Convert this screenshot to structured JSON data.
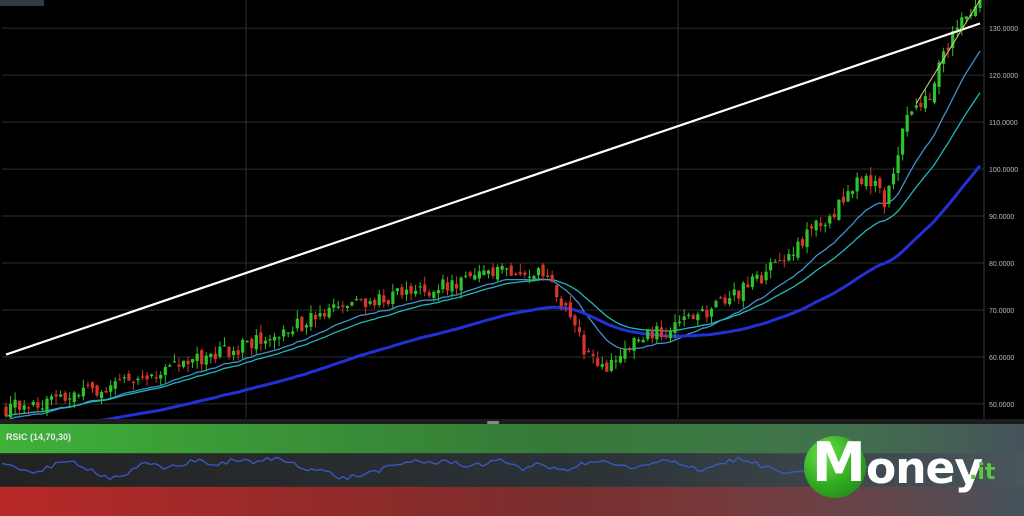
{
  "chart_data": [
    {
      "type": "candlestick",
      "title": "",
      "ylim": [
        47,
        136
      ],
      "yticks": [
        50,
        60,
        70,
        80,
        90,
        100,
        110,
        120,
        130
      ],
      "ytick_labels": [
        "50.0000",
        "60.0000",
        "70.0000",
        "80.0000",
        "90.0000",
        "100.0000",
        "110.0000",
        "120.0000",
        "130.0000"
      ],
      "grid": true,
      "candles": {
        "count": 215,
        "close": [
          [
            0,
            49
          ],
          [
            15,
            52
          ],
          [
            30,
            56
          ],
          [
            45,
            60
          ],
          [
            60,
            65
          ],
          [
            70,
            69
          ],
          [
            80,
            72
          ],
          [
            95,
            75
          ],
          [
            105,
            77
          ],
          [
            112,
            79
          ],
          [
            118,
            77
          ],
          [
            122,
            72
          ],
          [
            125,
            66
          ],
          [
            128,
            60
          ],
          [
            131,
            57
          ],
          [
            134,
            60
          ],
          [
            138,
            63
          ],
          [
            142,
            65
          ],
          [
            148,
            67
          ],
          [
            155,
            70
          ],
          [
            163,
            75
          ],
          [
            170,
            80
          ],
          [
            177,
            87
          ],
          [
            184,
            93
          ],
          [
            188,
            98
          ],
          [
            191,
            97
          ],
          [
            193,
            93
          ],
          [
            195,
            100
          ],
          [
            197,
            108
          ],
          [
            200,
            114
          ],
          [
            203,
            116
          ],
          [
            206,
            125
          ],
          [
            209,
            130
          ],
          [
            212,
            134
          ],
          [
            214,
            136
          ]
        ]
      },
      "trendlines": [
        {
          "points": [
            [
              0,
              60.5
            ],
            [
              214,
              131
            ]
          ],
          "color": "#ffffff"
        },
        {
          "points": [
            [
              200,
              114
            ],
            [
              214,
              136
            ]
          ],
          "color": "#d8cf7a"
        }
      ],
      "moving_averages": [
        {
          "period": "short",
          "color": "#3f90d0"
        },
        {
          "period": "medium",
          "color": "#1fb8b8"
        },
        {
          "period": "long",
          "color": "#2330d8"
        }
      ]
    },
    {
      "type": "line",
      "title": "RSIC (14,70,30)",
      "ylim": [
        0,
        100
      ],
      "levels": [
        70,
        30
      ],
      "series": [
        {
          "color": "#3c5ad0",
          "values": [
            55,
            52,
            48,
            56,
            60,
            50,
            40,
            46,
            58,
            52,
            57,
            62,
            55,
            63,
            58,
            64,
            60,
            52,
            48,
            40,
            44,
            50,
            55,
            62,
            58,
            60,
            55,
            58,
            61,
            52,
            57,
            49,
            55,
            60,
            58,
            51,
            56,
            61,
            57,
            50,
            58,
            63,
            57,
            50,
            45,
            48,
            55,
            60,
            52,
            56
          ]
        }
      ]
    }
  ],
  "rsi": {
    "label": "RSIC (14,70,30)"
  },
  "logo": {
    "m": "M",
    "rest": "oney",
    "tld": ".it"
  },
  "colors": {
    "bull": "#2fc22a",
    "bear": "#d8342c",
    "grid": "#2e2e2e",
    "axis_text": "#bbbbbb",
    "rsi_upper": "#3fb23a",
    "rsi_lower": "#b82a28",
    "logo_green": "#3cb62a"
  }
}
